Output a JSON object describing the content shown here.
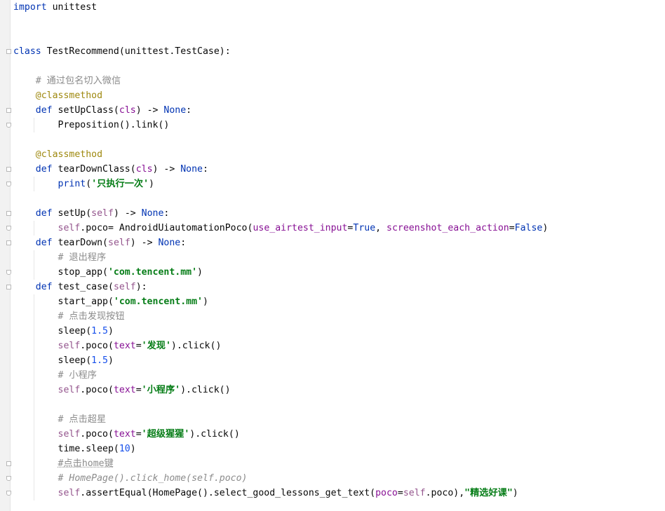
{
  "editor": {
    "language": "python",
    "lines": [
      [
        {
          "t": "import",
          "c": "kw"
        },
        {
          "t": " unittest",
          "c": ""
        }
      ],
      [],
      [],
      [
        {
          "t": "class",
          "c": "kw"
        },
        {
          "t": " TestRecommend(unittest.TestCase):",
          "c": ""
        }
      ],
      [],
      [
        {
          "t": "    # 通过包名切入微信",
          "c": "cmt"
        }
      ],
      [
        {
          "t": "    ",
          "c": ""
        },
        {
          "t": "@classmethod",
          "c": "dec"
        }
      ],
      [
        {
          "t": "    ",
          "c": ""
        },
        {
          "t": "def",
          "c": "kw"
        },
        {
          "t": " setUpClass(",
          "c": ""
        },
        {
          "t": "cls",
          "c": "param"
        },
        {
          "t": ") -> ",
          "c": ""
        },
        {
          "t": "None",
          "c": "kw"
        },
        {
          "t": ":",
          "c": ""
        }
      ],
      [
        {
          "t": "        Preposition().link()",
          "c": ""
        }
      ],
      [],
      [
        {
          "t": "    ",
          "c": ""
        },
        {
          "t": "@classmethod",
          "c": "dec"
        }
      ],
      [
        {
          "t": "    ",
          "c": ""
        },
        {
          "t": "def",
          "c": "kw"
        },
        {
          "t": " tearDownClass(",
          "c": ""
        },
        {
          "t": "cls",
          "c": "param"
        },
        {
          "t": ") -> ",
          "c": ""
        },
        {
          "t": "None",
          "c": "kw"
        },
        {
          "t": ":",
          "c": ""
        }
      ],
      [
        {
          "t": "        ",
          "c": ""
        },
        {
          "t": "print",
          "c": "kw"
        },
        {
          "t": "(",
          "c": ""
        },
        {
          "t": "'只执行一次'",
          "c": "str"
        },
        {
          "t": ")",
          "c": ""
        }
      ],
      [],
      [
        {
          "t": "    ",
          "c": ""
        },
        {
          "t": "def",
          "c": "kw"
        },
        {
          "t": " setUp(",
          "c": ""
        },
        {
          "t": "self",
          "c": "self"
        },
        {
          "t": ") -> ",
          "c": ""
        },
        {
          "t": "None",
          "c": "kw"
        },
        {
          "t": ":",
          "c": ""
        }
      ],
      [
        {
          "t": "        ",
          "c": ""
        },
        {
          "t": "self",
          "c": "self"
        },
        {
          "t": ".poco= AndroidUiautomationPoco(",
          "c": ""
        },
        {
          "t": "use_airtest_input",
          "c": "param"
        },
        {
          "t": "=",
          "c": ""
        },
        {
          "t": "True",
          "c": "kw"
        },
        {
          "t": ", ",
          "c": ""
        },
        {
          "t": "screenshot_each_action",
          "c": "param"
        },
        {
          "t": "=",
          "c": ""
        },
        {
          "t": "False",
          "c": "kw"
        },
        {
          "t": ")",
          "c": ""
        }
      ],
      [
        {
          "t": "    ",
          "c": ""
        },
        {
          "t": "def",
          "c": "kw"
        },
        {
          "t": " tearDown(",
          "c": ""
        },
        {
          "t": "self",
          "c": "self"
        },
        {
          "t": ") -> ",
          "c": ""
        },
        {
          "t": "None",
          "c": "kw"
        },
        {
          "t": ":",
          "c": ""
        }
      ],
      [
        {
          "t": "        # 退出程序",
          "c": "cmt"
        }
      ],
      [
        {
          "t": "        stop_app(",
          "c": ""
        },
        {
          "t": "'com.tencent.mm'",
          "c": "str"
        },
        {
          "t": ")",
          "c": ""
        }
      ],
      [
        {
          "t": "    ",
          "c": ""
        },
        {
          "t": "def",
          "c": "kw"
        },
        {
          "t": " test_case(",
          "c": ""
        },
        {
          "t": "self",
          "c": "self"
        },
        {
          "t": "):",
          "c": ""
        }
      ],
      [
        {
          "t": "        start_app(",
          "c": ""
        },
        {
          "t": "'com.tencent.mm'",
          "c": "str"
        },
        {
          "t": ")",
          "c": ""
        }
      ],
      [
        {
          "t": "        # 点击发现按钮",
          "c": "cmt"
        }
      ],
      [
        {
          "t": "        sleep(",
          "c": ""
        },
        {
          "t": "1.5",
          "c": "num"
        },
        {
          "t": ")",
          "c": ""
        }
      ],
      [
        {
          "t": "        ",
          "c": ""
        },
        {
          "t": "self",
          "c": "self"
        },
        {
          "t": ".poco(",
          "c": ""
        },
        {
          "t": "text",
          "c": "param"
        },
        {
          "t": "=",
          "c": ""
        },
        {
          "t": "'发现'",
          "c": "str"
        },
        {
          "t": ").click()",
          "c": ""
        }
      ],
      [
        {
          "t": "        sleep(",
          "c": ""
        },
        {
          "t": "1.5",
          "c": "num"
        },
        {
          "t": ")",
          "c": ""
        }
      ],
      [
        {
          "t": "        # 小程序",
          "c": "cmt"
        }
      ],
      [
        {
          "t": "        ",
          "c": ""
        },
        {
          "t": "self",
          "c": "self"
        },
        {
          "t": ".poco(",
          "c": ""
        },
        {
          "t": "text",
          "c": "param"
        },
        {
          "t": "=",
          "c": ""
        },
        {
          "t": "'小程序'",
          "c": "str"
        },
        {
          "t": ").click()",
          "c": ""
        }
      ],
      [],
      [
        {
          "t": "        # 点击超星",
          "c": "cmt"
        }
      ],
      [
        {
          "t": "        ",
          "c": ""
        },
        {
          "t": "self",
          "c": "self"
        },
        {
          "t": ".poco(",
          "c": ""
        },
        {
          "t": "text",
          "c": "param"
        },
        {
          "t": "=",
          "c": ""
        },
        {
          "t": "'超级猩猩'",
          "c": "str"
        },
        {
          "t": ").click()",
          "c": ""
        }
      ],
      [
        {
          "t": "        time.sleep(",
          "c": ""
        },
        {
          "t": "10",
          "c": "num"
        },
        {
          "t": ")",
          "c": ""
        }
      ],
      [
        {
          "t": "        ",
          "c": ""
        },
        {
          "t": "#点击home键",
          "c": "cmt under"
        }
      ],
      [
        {
          "t": "        ",
          "c": ""
        },
        {
          "t": "# HomePage().click_home(self.poco)",
          "c": "cmt-it"
        }
      ],
      [
        {
          "t": "        ",
          "c": ""
        },
        {
          "t": "self",
          "c": "self"
        },
        {
          "t": ".assertEqual(HomePage().select_good_lessons_get_text(",
          "c": ""
        },
        {
          "t": "poco",
          "c": "param"
        },
        {
          "t": "=",
          "c": ""
        },
        {
          "t": "self",
          "c": "self"
        },
        {
          "t": ".poco),",
          "c": ""
        },
        {
          "t": "\"精选好课\"",
          "c": "str"
        },
        {
          "t": ")",
          "c": ""
        }
      ]
    ]
  }
}
